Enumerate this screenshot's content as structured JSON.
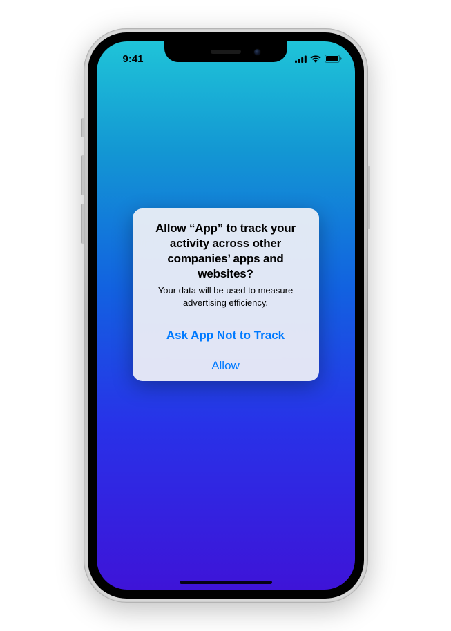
{
  "status_bar": {
    "time": "9:41"
  },
  "dialog": {
    "title": "Allow “App” to track your activity across other companies’ apps and websites?",
    "message": "Your data will be used to measure advertising efficiency.",
    "deny_label": "Ask App Not to Track",
    "allow_label": "Allow"
  },
  "colors": {
    "ios_blue": "#007AFF"
  }
}
